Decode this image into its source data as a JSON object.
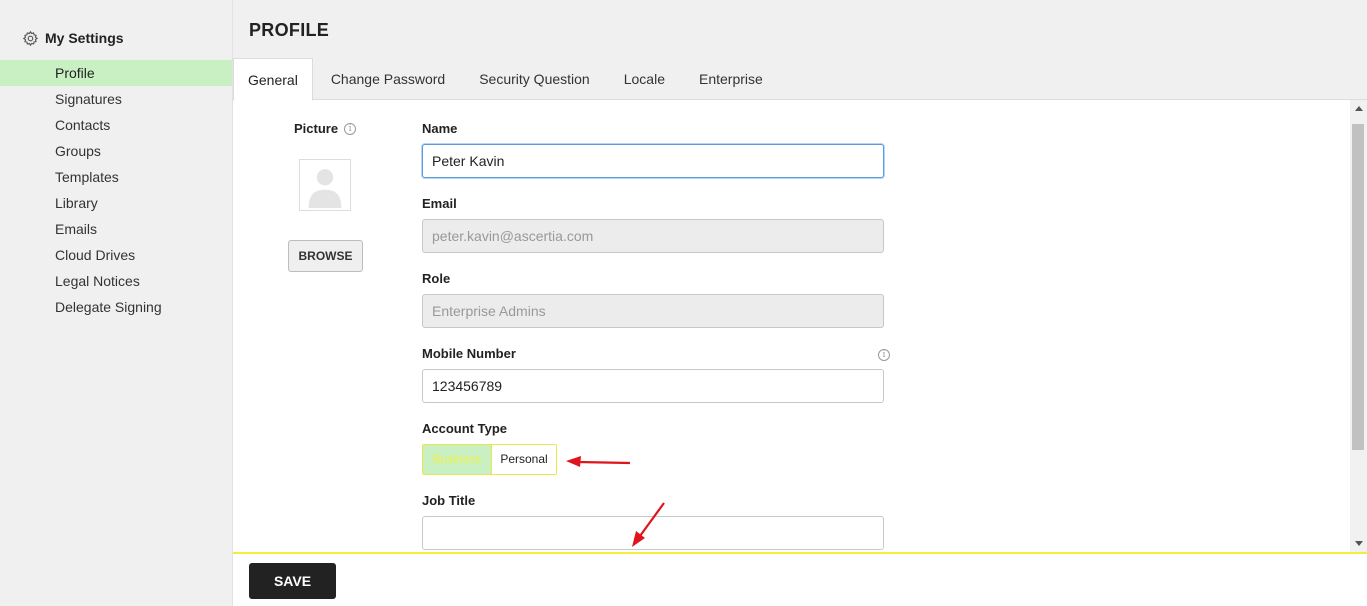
{
  "sidebar": {
    "title": "My Settings",
    "items": [
      {
        "label": "Profile",
        "active": true
      },
      {
        "label": "Signatures"
      },
      {
        "label": "Contacts"
      },
      {
        "label": "Groups"
      },
      {
        "label": "Templates"
      },
      {
        "label": "Library"
      },
      {
        "label": "Emails"
      },
      {
        "label": "Cloud Drives"
      },
      {
        "label": "Legal Notices"
      },
      {
        "label": "Delegate Signing"
      }
    ]
  },
  "header": {
    "title": "PROFILE",
    "tabs": [
      {
        "label": "General",
        "active": true
      },
      {
        "label": "Change Password"
      },
      {
        "label": "Security Question"
      },
      {
        "label": "Locale"
      },
      {
        "label": "Enterprise"
      }
    ]
  },
  "picture": {
    "label": "Picture",
    "browse_label": "BROWSE"
  },
  "form": {
    "name": {
      "label": "Name",
      "value": "Peter Kavin"
    },
    "email": {
      "label": "Email",
      "value": "peter.kavin@ascertia.com"
    },
    "role": {
      "label": "Role",
      "value": "Enterprise Admins"
    },
    "mobile": {
      "label": "Mobile Number",
      "value": "123456789"
    },
    "account_type": {
      "label": "Account Type",
      "options": [
        "Business",
        "Personal"
      ],
      "selected": "Business"
    },
    "job_title": {
      "label": "Job Title",
      "value": ""
    }
  },
  "footer": {
    "save_label": "SAVE"
  },
  "colors": {
    "active_green": "#c9f0c2",
    "highlight_yellow": "#f2ee3a",
    "annotation_red": "#e0141e",
    "save_button": "#222222"
  },
  "icons": {
    "settings": "gear-icon",
    "info": "info-icon",
    "avatar": "user-silhouette-icon",
    "annotation": "red-arrow-icon"
  }
}
